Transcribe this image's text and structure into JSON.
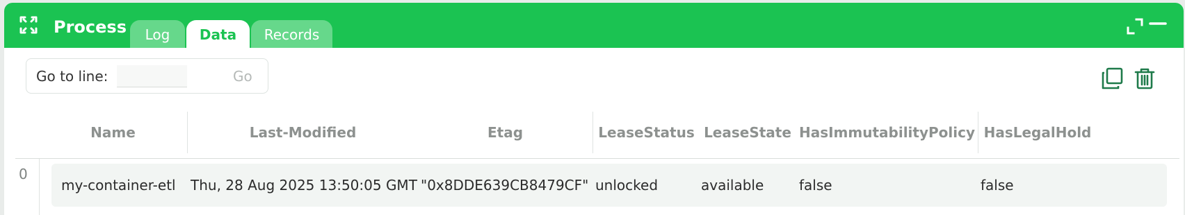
{
  "header": {
    "title": "Process",
    "tabs": [
      {
        "label": "Log",
        "active": false
      },
      {
        "label": "Data",
        "active": true
      },
      {
        "label": "Records",
        "active": false
      }
    ]
  },
  "toolbar": {
    "goto_label": "Go to line:",
    "goto_value": "",
    "goto_button": "Go",
    "icons": [
      "copy-icon",
      "trash-icon"
    ]
  },
  "table": {
    "columns": [
      "Name",
      "Last-Modified",
      "Etag",
      "LeaseStatus",
      "LeaseState",
      "HasImmutabilityPolicy",
      "HasLegalHold"
    ],
    "rows": [
      {
        "index": "0",
        "cells": [
          "my-container-etl",
          "Thu, 28 Aug 2025 13:50:05 GMT",
          "\"0x8DDE639CB8479CF\"",
          "unlocked",
          "available",
          "false",
          "false"
        ]
      }
    ]
  },
  "colors": {
    "header": "#1bc352",
    "tab_inactive": "#66d88b",
    "icon": "#1e7a4a"
  }
}
